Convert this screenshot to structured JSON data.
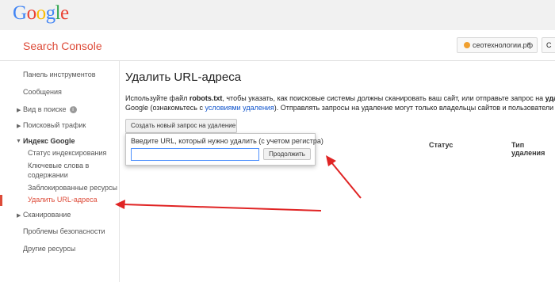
{
  "app": {
    "logo_letters": [
      {
        "ch": "G",
        "color": "#4285f4"
      },
      {
        "ch": "o",
        "color": "#ea4335"
      },
      {
        "ch": "o",
        "color": "#fbbc05"
      },
      {
        "ch": "g",
        "color": "#4285f4"
      },
      {
        "ch": "l",
        "color": "#34a853"
      },
      {
        "ch": "e",
        "color": "#ea4335"
      }
    ],
    "product_title": "Search Console",
    "site_selector": "сеотехнологии.рф",
    "accent_color": "#dd4b39",
    "annotation_arrow_color": "#e02424"
  },
  "sidebar": {
    "dashboard": "Панель инструментов",
    "messages": "Сообщения",
    "search_appearance": "Вид в поиске",
    "search_traffic": "Поисковый трафик",
    "google_index": "Индекс Google",
    "index_status": "Статус индексирования",
    "keywords_line1": "Ключевые слова в",
    "keywords_line2": "содержании",
    "blocked_resources": "Заблокированные ресурсы",
    "remove_urls": "Удалить URL-адреса",
    "crawl": "Сканирование",
    "security_issues": "Проблемы безопасности",
    "other_resources": "Другие ресурсы"
  },
  "main": {
    "title": "Удалить URL-адреса",
    "desc1_pre": "Используйте файл ",
    "desc1_bold": "robots.txt",
    "desc1_mid": ", чтобы указать, как поисковые системы должны сканировать ваш сайт, или отправьте запрос на ",
    "desc1_bold2": "удаление",
    "desc2_pre": "Google (ознакомьтесь с ",
    "desc2_link": "условиями удаления",
    "desc2_post": "). Отправлять запросы на удаление могут только владельцы сайтов и пользователи с полны",
    "create_button": "Создать новый запрос на удаление",
    "col_status": "Статус",
    "col_type": "Тип удаления",
    "popup_label": "Введите URL, который нужно удалить (с учетом регистра)",
    "url_value": "",
    "continue_button": "Продолжить"
  }
}
